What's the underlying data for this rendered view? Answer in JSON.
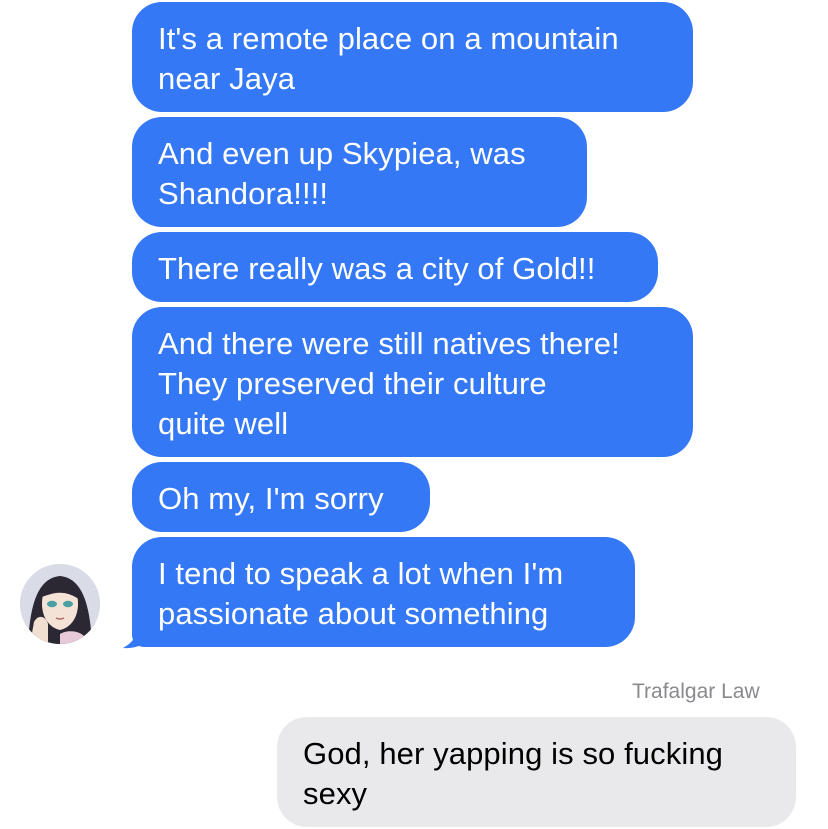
{
  "messages": [
    {
      "text": "It's a remote place on a mountain\nnear Jaya"
    },
    {
      "text": "And even up Skypiea, was\nShandora!!!!"
    },
    {
      "text": "There really was a city of Gold!!"
    },
    {
      "text": "And there were still natives there!\nThey preserved their culture\nquite well"
    },
    {
      "text": "Oh my, I'm sorry"
    },
    {
      "text": "I tend to speak a lot when I'm\npassionate about something"
    }
  ],
  "reply": {
    "sender": "Trafalgar Law",
    "text": "God, her yapping is so fucking\nsexy"
  },
  "colors": {
    "incoming_bubble": "#3478f6",
    "outgoing_bubble": "#e9e9eb",
    "sender_name": "#8a8a8e"
  },
  "icons": {
    "avatar": "contact-avatar"
  }
}
